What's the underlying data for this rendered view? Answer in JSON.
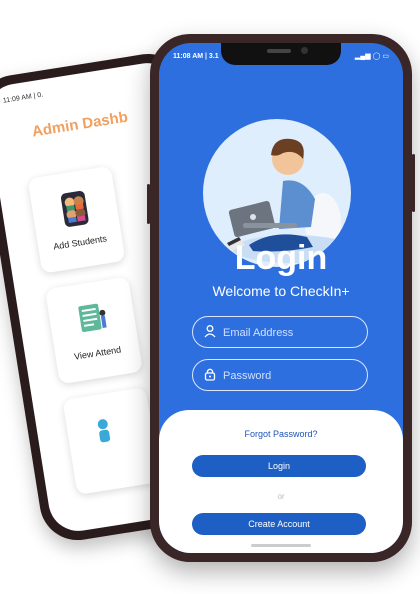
{
  "back_screen": {
    "status_time": "11:09 AM | 0.",
    "title": "Admin Dashb",
    "cards": [
      {
        "label": "Add Students",
        "icon": "students-icon"
      },
      {
        "label": "View Attend",
        "icon": "attendance-icon"
      },
      {
        "label": "",
        "icon": "person-icon"
      }
    ]
  },
  "front_screen": {
    "status_time": "11:08 AM | 3.1",
    "status_icons": "▂▄▆ ◯ ▭",
    "login_title": "Login",
    "welcome": "Welcome to CheckIn+",
    "email_placeholder": "Email Address",
    "password_placeholder": "Password",
    "forgot_password": "Forgot Password?",
    "login_button": "Login",
    "or_text": "or",
    "create_account_button": "Create Account"
  },
  "colors": {
    "primary": "#2e6fe0",
    "button": "#1d5fc4",
    "accent_title": "#f0a060",
    "phone_frame": "#3a2527"
  }
}
